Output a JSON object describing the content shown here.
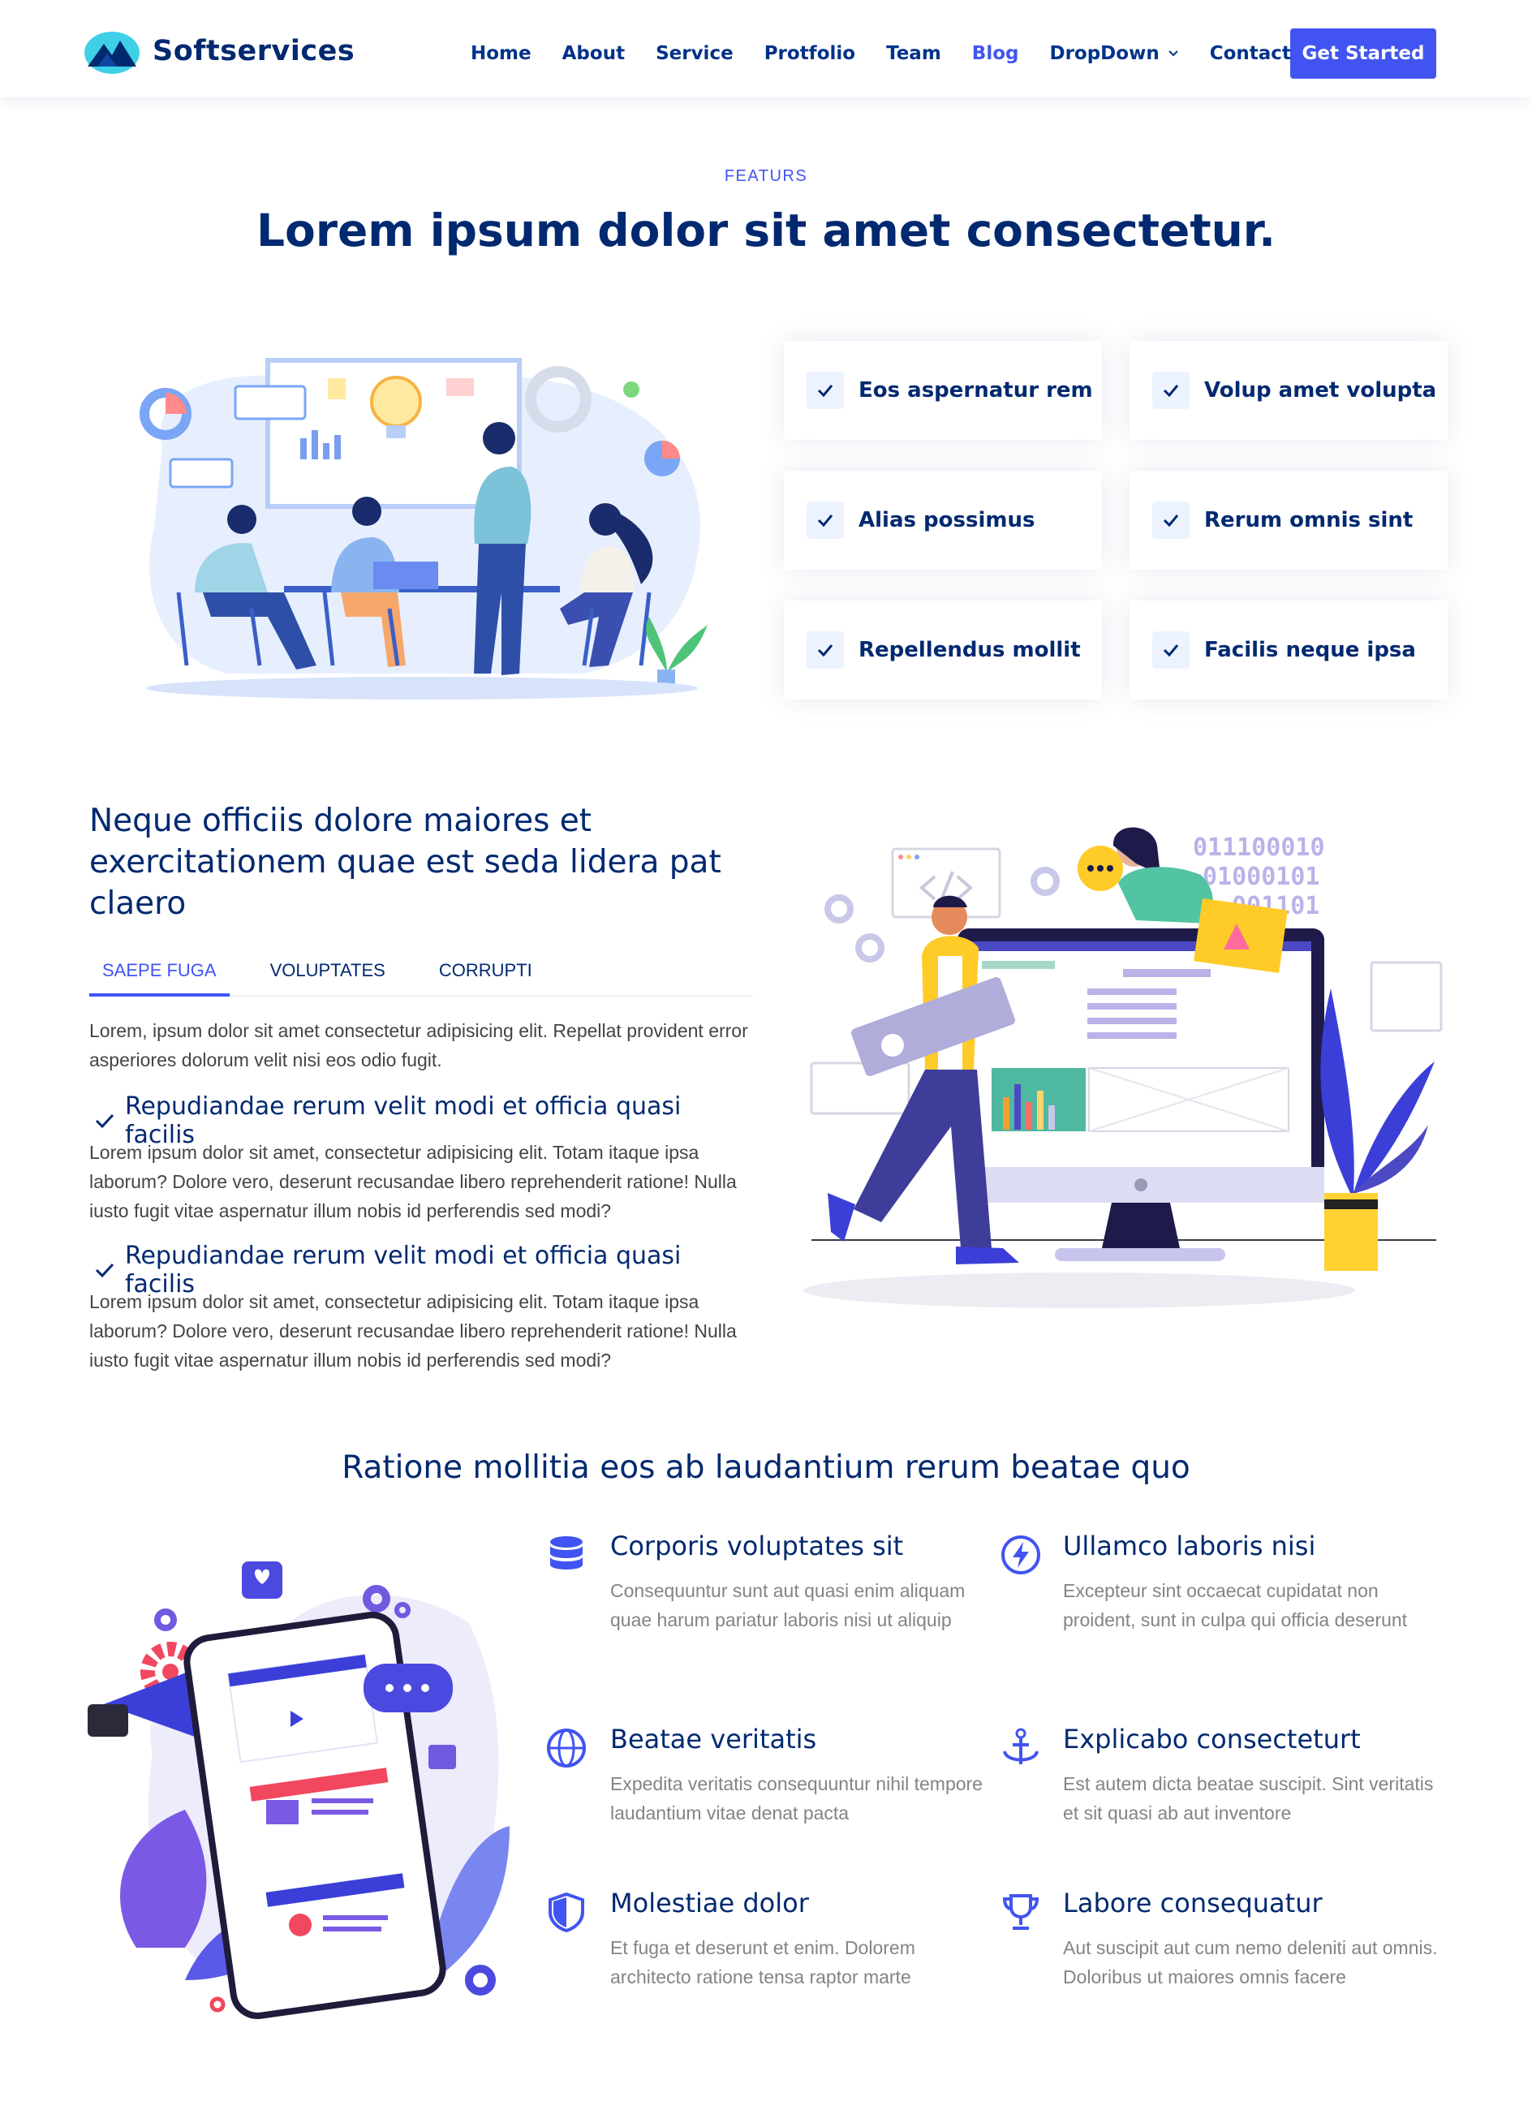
{
  "header": {
    "logo_text": "Softservices",
    "nav": [
      {
        "label": "Home",
        "active": false
      },
      {
        "label": "About",
        "active": false
      },
      {
        "label": "Service",
        "active": false
      },
      {
        "label": "Protfolio",
        "active": false
      },
      {
        "label": "Team",
        "active": false
      },
      {
        "label": "Blog",
        "active": true
      },
      {
        "label": "DropDown",
        "active": false
      },
      {
        "label": "Contact",
        "active": false
      }
    ],
    "cta_label": "Get Started"
  },
  "features": {
    "eyebrow": "FEATURS",
    "title": "Lorem ipsum dolor sit amet consectetur.",
    "items": [
      "Eos aspernatur rem",
      "Volup amet volupta",
      "Alias possimus",
      "Rerum omnis sint",
      "Repellendus mollit",
      "Facilis neque ipsa"
    ]
  },
  "tabs_section": {
    "title": "Neque officiis dolore maiores et exercitationem quae est seda lidera pat claero",
    "tabs": [
      {
        "label": "SAEPE FUGA",
        "active": true
      },
      {
        "label": "VOLUPTATES",
        "active": false
      },
      {
        "label": "CORRUPTI",
        "active": false
      }
    ],
    "intro": "Lorem, ipsum dolor sit amet consectetur adipisicing elit. Repellat provident error asperiores dolorum velit nisi eos odio fugit.",
    "points": [
      {
        "title": "Repudiandae rerum velit modi et officia quasi facilis",
        "text": "Lorem ipsum dolor sit amet, consectetur adipisicing elit. Totam itaque ipsa laborum? Dolore vero, deserunt recusandae libero reprehenderit ratione! Nulla iusto fugit vitae aspernatur illum nobis id perferendis sed modi?"
      },
      {
        "title": "Repudiandae rerum velit modi et officia quasi facilis",
        "text": "Lorem ipsum dolor sit amet, consectetur adipisicing elit. Totam itaque ipsa laborum? Dolore vero, deserunt recusandae libero reprehenderit ratione! Nulla iusto fugit vitae aspernatur illum nobis id perferendis sed modi?"
      }
    ],
    "binary_text": [
      "011100010",
      "01000101",
      "001101"
    ]
  },
  "icons_section": {
    "title": "Ratione mollitia eos ab laudantium rerum beatae quo",
    "items": [
      {
        "icon": "database-icon",
        "title": "Corporis voluptates sit",
        "text": "Consequuntur sunt aut quasi enim aliquam quae harum pariatur laboris nisi ut aliquip"
      },
      {
        "icon": "lightning-icon",
        "title": "Ullamco laboris nisi",
        "text": "Excepteur sint occaecat cupidatat non proident, sunt in culpa qui officia deserunt"
      },
      {
        "icon": "globe-icon",
        "title": "Beatae veritatis",
        "text": "Expedita veritatis consequuntur nihil tempore laudantium vitae denat pacta"
      },
      {
        "icon": "anchor-icon",
        "title": "Explicabo consecteturt",
        "text": "Est autem dicta beatae suscipit. Sint veritatis et sit quasi ab aut inventore"
      },
      {
        "icon": "shield-icon",
        "title": "Molestiae dolor",
        "text": "Et fuga et deserunt et enim. Dolorem architecto ratione tensa raptor marte"
      },
      {
        "icon": "trophy-icon",
        "title": "Labore consequatur",
        "text": "Aut suscipit aut cum nemo deleniti aut omnis. Doloribus ut maiores omnis facere"
      }
    ]
  },
  "colors": {
    "accent": "#4154f1",
    "heading": "#012970",
    "muted": "#848484",
    "text": "#444444"
  }
}
